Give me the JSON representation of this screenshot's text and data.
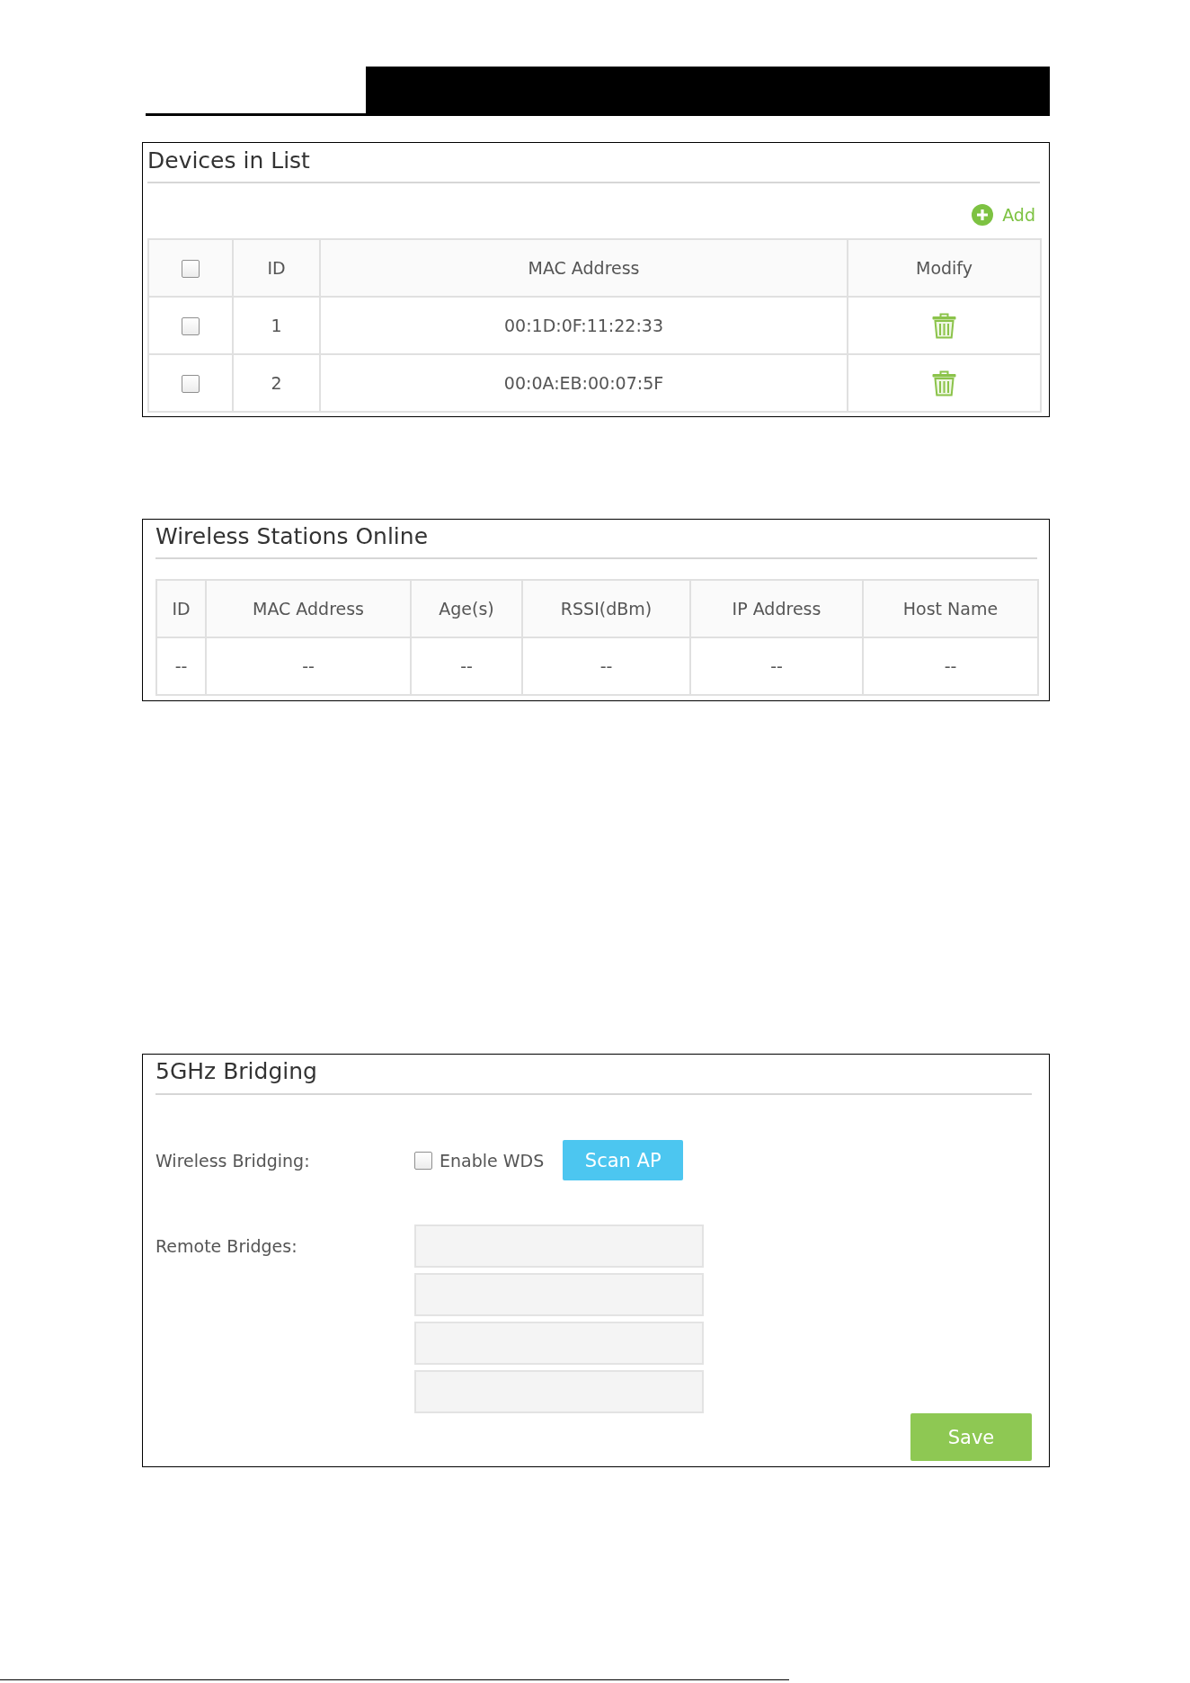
{
  "devices_in_list": {
    "title": "Devices in List",
    "add_button": "Add",
    "table": {
      "select_all": {
        "checked": false
      },
      "columns": [
        "ID",
        "MAC Address",
        "Modify"
      ],
      "rows": [
        {
          "checked": false,
          "id": "1",
          "mac_address": "00:1D:0F:11:22:33"
        },
        {
          "checked": false,
          "id": "2",
          "mac_address": "00:0A:EB:00:07:5F"
        }
      ]
    }
  },
  "wireless_stations_online": {
    "title": "Wireless Stations Online",
    "table": {
      "columns": [
        "ID",
        "MAC Address",
        "Age(s)",
        "RSSI(dBm)",
        "IP Address",
        "Host Name"
      ],
      "rows": [
        [
          "--",
          "--",
          "--",
          "--",
          "--",
          "--"
        ]
      ]
    }
  },
  "bridging_5ghz": {
    "title": "5GHz Bridging",
    "wireless_bridging": {
      "label": "Wireless Bridging:",
      "enable_wds": {
        "label": "Enable WDS",
        "checked": false
      },
      "scan_button": "Scan AP"
    },
    "remote_bridges": {
      "label": "Remote Bridges:",
      "fields": [
        {
          "disabled": true
        },
        {
          "disabled": true
        },
        {
          "disabled": true
        },
        {
          "disabled": true
        }
      ]
    },
    "save_button": "Save"
  }
}
